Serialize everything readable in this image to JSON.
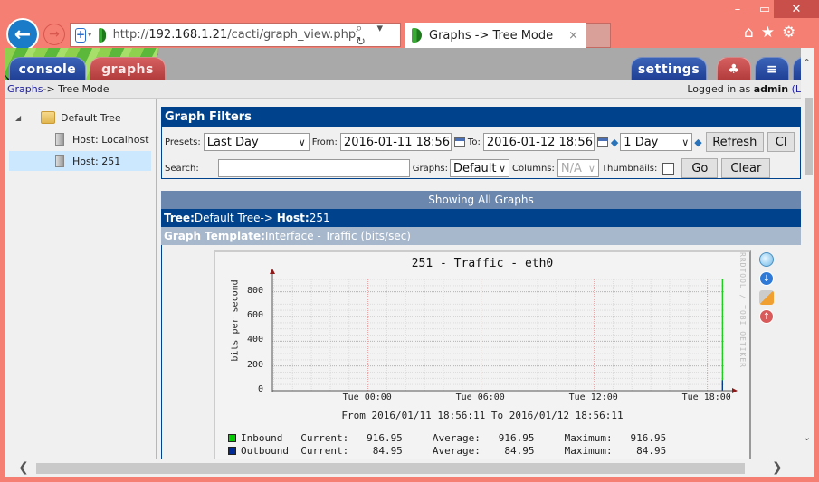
{
  "window": {
    "minimize_icon": "–",
    "maximize_icon": "▭",
    "close_icon": "✕"
  },
  "browser": {
    "back_icon": "←",
    "forward_icon": "→",
    "url_prefix": "http://",
    "url_host": "192.168.1.21",
    "url_path": "/cacti/graph_view.php",
    "url_tools": "⌕ ▾ ↻",
    "tab_title": "Graphs -> Tree Mode",
    "tab_close": "×",
    "home_icon": "⌂",
    "favorites_icon": "★",
    "settings_icon": "⚙"
  },
  "topnav": {
    "console": "console",
    "graphs": "graphs",
    "settings": "settings",
    "tree_icon": "♣",
    "list_icon": "≡"
  },
  "breadcrumb": {
    "link": "Graphs",
    "rest": " -> Tree Mode",
    "login_prefix": "Logged in as ",
    "user": "admin",
    "logout_start": " (L"
  },
  "tree": {
    "expander": "◢",
    "root": "Default Tree",
    "hosts": [
      "Host: Localhost",
      "Host: 251"
    ],
    "selected": "Host: 251"
  },
  "filters": {
    "title": "Graph Filters",
    "presets_label": "Presets:",
    "presets_value": "Last Day",
    "from_label": "From:",
    "from_value": "2016-01-11 18:56",
    "to_label": "To:",
    "to_value": "2016-01-12 18:56",
    "timespan_value": "1 Day",
    "refresh_label": "Refresh",
    "clear_partial": "Cl",
    "search_label": "Search:",
    "search_value": "",
    "graphs_label": "Graphs:",
    "graphs_value": "Default",
    "columns_label": "Columns:",
    "columns_value": "N/A",
    "thumbnails_label": "Thumbnails:",
    "thumbnails_checked": false,
    "go_label": "Go",
    "clear_label": "Clear",
    "chevron": "∨",
    "shift_left": "◆",
    "shift_right": "◆"
  },
  "results": {
    "showing": "Showing All Graphs",
    "tree_label": "Tree:",
    "tree_value": "Default Tree->",
    "host_label": "Host:",
    "host_value": "251",
    "template_label": "Graph Template:",
    "template_value": " Interface - Traffic (bits/sec)"
  },
  "graph": {
    "title": "251 - Traffic - eth0",
    "ylabel": "bits per second",
    "watermark": "RRDTOOL / TOBI OETIKER",
    "yticks": [
      "800",
      "600",
      "400",
      "200",
      "0"
    ],
    "xticks": [
      "Tue 00:00",
      "Tue 06:00",
      "Tue 12:00",
      "Tue 18:00"
    ],
    "time_range": "From 2016/01/11 18:56:11 To 2016/01/12 18:56:11",
    "legend": [
      {
        "name": "Inbound",
        "color": "#00cc00",
        "current": "916.95",
        "average": "916.95",
        "maximum": "916.95"
      },
      {
        "name": "Outbound",
        "color": "#002a97",
        "current": "84.95",
        "average": "84.95",
        "maximum": "84.95"
      }
    ],
    "current_label": "Current:",
    "average_label": "Average:",
    "maximum_label": "Maximum:",
    "actions": [
      "zoom-icon",
      "download-icon",
      "edit-icon",
      "up-icon"
    ]
  },
  "chart_data": {
    "type": "line",
    "title": "251 - Traffic - eth0",
    "xlabel": "",
    "ylabel": "bits per second",
    "ylim": [
      0,
      900
    ],
    "x_ticks": [
      "Tue 00:00",
      "Tue 06:00",
      "Tue 12:00",
      "Tue 18:00"
    ],
    "x_range_hours": [
      -5.07,
      18.93
    ],
    "series": [
      {
        "name": "Inbound",
        "color": "#00cc00",
        "points": [
          [
            18.8,
            0
          ],
          [
            18.8,
            916.95
          ]
        ]
      },
      {
        "name": "Outbound",
        "color": "#002a97",
        "points": [
          [
            18.8,
            0
          ],
          [
            18.8,
            84.95
          ]
        ]
      }
    ],
    "grid": true,
    "legend": "bottom"
  },
  "scroll": {
    "up": "⌃",
    "down": "⌄",
    "left": "❮",
    "right": "❯"
  }
}
